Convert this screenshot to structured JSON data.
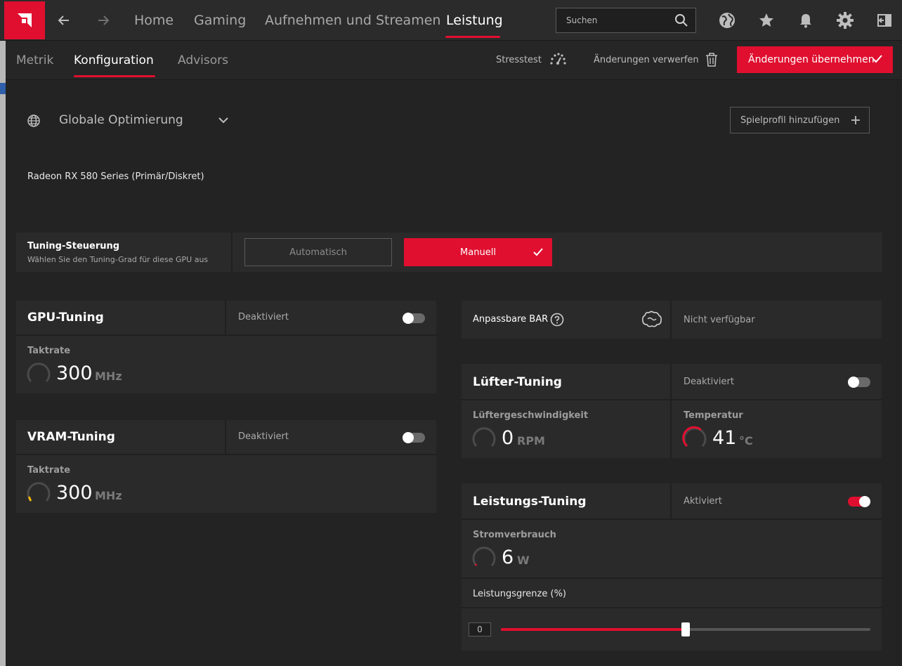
{
  "topbar": {
    "tabs": [
      "Home",
      "Gaming",
      "Aufnehmen und Streamen",
      "Leistung"
    ],
    "active_tab": "Leistung",
    "search_placeholder": "Suchen"
  },
  "subbar": {
    "tabs": [
      "Metrik",
      "Konfiguration",
      "Advisors"
    ],
    "active_tab": "Konfiguration",
    "stresstest": "Stresstest",
    "discard": "Änderungen verwerfen",
    "apply": "Änderungen übernehmen"
  },
  "profile": {
    "label": "Globale Optimierung",
    "add_profile": "Spielprofil hinzufügen"
  },
  "gpu_name": "Radeon RX 580 Series (Primär/Diskret)",
  "tuning_control": {
    "title": "Tuning-Steuerung",
    "subtitle": "Wählen Sie den Tuning-Grad für diese GPU aus",
    "auto_label": "Automatisch",
    "manual_label": "Manuell",
    "selected": "Manuell"
  },
  "gpu_tuning": {
    "title": "GPU-Tuning",
    "status": "Deaktiviert",
    "enabled": false,
    "metric_label": "Taktrate",
    "value": "300",
    "unit": "MHz"
  },
  "vram_tuning": {
    "title": "VRAM-Tuning",
    "status": "Deaktiviert",
    "enabled": false,
    "metric_label": "Taktrate",
    "value": "300",
    "unit": "MHz"
  },
  "resizable_bar": {
    "label": "Anpassbare BAR",
    "status": "Nicht verfügbar"
  },
  "fan_tuning": {
    "title": "Lüfter-Tuning",
    "status": "Deaktiviert",
    "enabled": false,
    "fan_label": "Lüftergeschwindigkeit",
    "fan_value": "0",
    "fan_unit": "RPM",
    "temp_label": "Temperatur",
    "temp_value": "41",
    "temp_unit": "°C"
  },
  "power_tuning": {
    "title": "Leistungs-Tuning",
    "status": "Aktiviert",
    "enabled": true,
    "power_label": "Stromverbrauch",
    "power_value": "6",
    "power_unit": "W",
    "limit_label": "Leistungsgrenze (%)",
    "limit_value": "0",
    "limit_fraction": 0.5
  },
  "colors": {
    "accent": "#e00f2f",
    "background": "#232323",
    "panel": "#2a2a2a",
    "gauge_vram": "#f2b705"
  }
}
